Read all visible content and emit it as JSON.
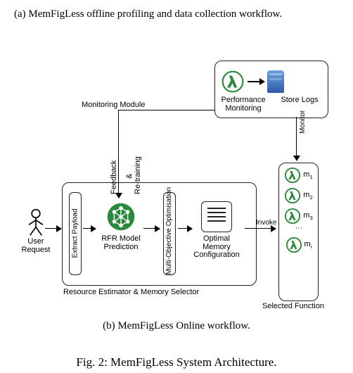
{
  "caption_a": "(a) MemFigLess offline profiling and data collection workflow.",
  "caption_b": "(b) MemFigLess Online workflow.",
  "fig_caption": "Fig. 2: MemFigLess System Architecture.",
  "diagram": {
    "monitoring_module": {
      "label": "Monitoring Module",
      "perf_label": "Performance Monitoring",
      "store_label": "Store Logs"
    },
    "monitor_arrow_label": "Monitor",
    "feedback_label": "Feedback & Re-training",
    "user_label": "User Request",
    "extract_payload": "Extract Payload",
    "rfr_label": "RFR Model Prediction",
    "multi_objective": "Multi-Objective Optimisation",
    "optimal_label": "Optimal Memory Configuration",
    "invoke_label": "Invoke",
    "estimator_label": "Resource Estimator & Memory Selector",
    "selected_function": {
      "label": "Selected Function",
      "items": [
        "m₁",
        "m₂",
        "m₃",
        "mᵢ"
      ]
    }
  }
}
